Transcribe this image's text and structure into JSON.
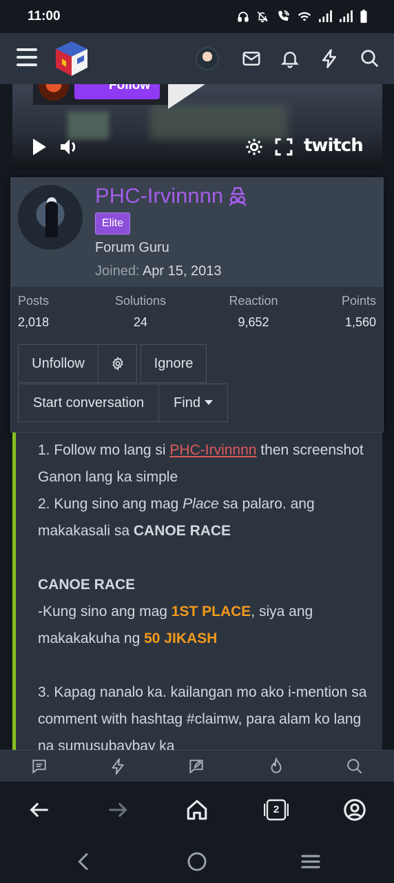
{
  "status": {
    "time": "11:00",
    "icons": [
      "headphones-icon",
      "mute-icon",
      "wifi-call-icon",
      "wifi-icon",
      "signal-icon",
      "signal-icon",
      "battery-icon"
    ]
  },
  "header": {
    "icons": [
      "menu-icon",
      "site-logo",
      "user-avatar",
      "inbox-icon",
      "bell-icon",
      "bolt-icon",
      "search-icon"
    ]
  },
  "video": {
    "follow_label": "Follow",
    "brand": "twitch"
  },
  "profile": {
    "name": "PHC-Irvinnnn",
    "badge": "Elite",
    "title": "Forum Guru",
    "joined_label": "Joined:",
    "joined_value": "Apr 15, 2013",
    "stats": [
      {
        "label": "Posts",
        "value": "2,018"
      },
      {
        "label": "Solutions",
        "value": "24"
      },
      {
        "label": "Reaction",
        "value": "9,652"
      },
      {
        "label": "Points",
        "value": "1,560"
      }
    ],
    "buttons": {
      "unfollow": "Unfollow",
      "ignore": "Ignore",
      "start_conversation": "Start conversation",
      "find": "Find"
    }
  },
  "post": {
    "l1a": "1. Follow mo lang si ",
    "l1link": "PHC-Irvinnnn",
    "l1b": " then screenshot Ganon lang ka simple",
    "l2a": "2. Kung sino ang mag ",
    "l2i": "Place",
    "l2b": " sa palaro. ang makakasali sa ",
    "l2bold": "CANOE RACE",
    "heading": "CANOE RACE",
    "l3a": "-Kung sino ang mag ",
    "l3o": "1ST PLACE",
    "l3b": ", siya ang makakakuha ng ",
    "l3o2": "50 JIKASH",
    "l4": "3. Kapag nanalo ka. kailangan mo ako i-mention sa comment with hashtag #claimw, para alam ko lang na sumusubaybay ka"
  },
  "browser": {
    "tab_count": "2"
  },
  "colors": {
    "accent_purple": "#a35de8",
    "badge_purple": "#8c4fd9",
    "link_red": "#e05a5a",
    "highlight_orange": "#f29a1c",
    "quote_green": "#86c01f",
    "panel": "#2c3440"
  }
}
